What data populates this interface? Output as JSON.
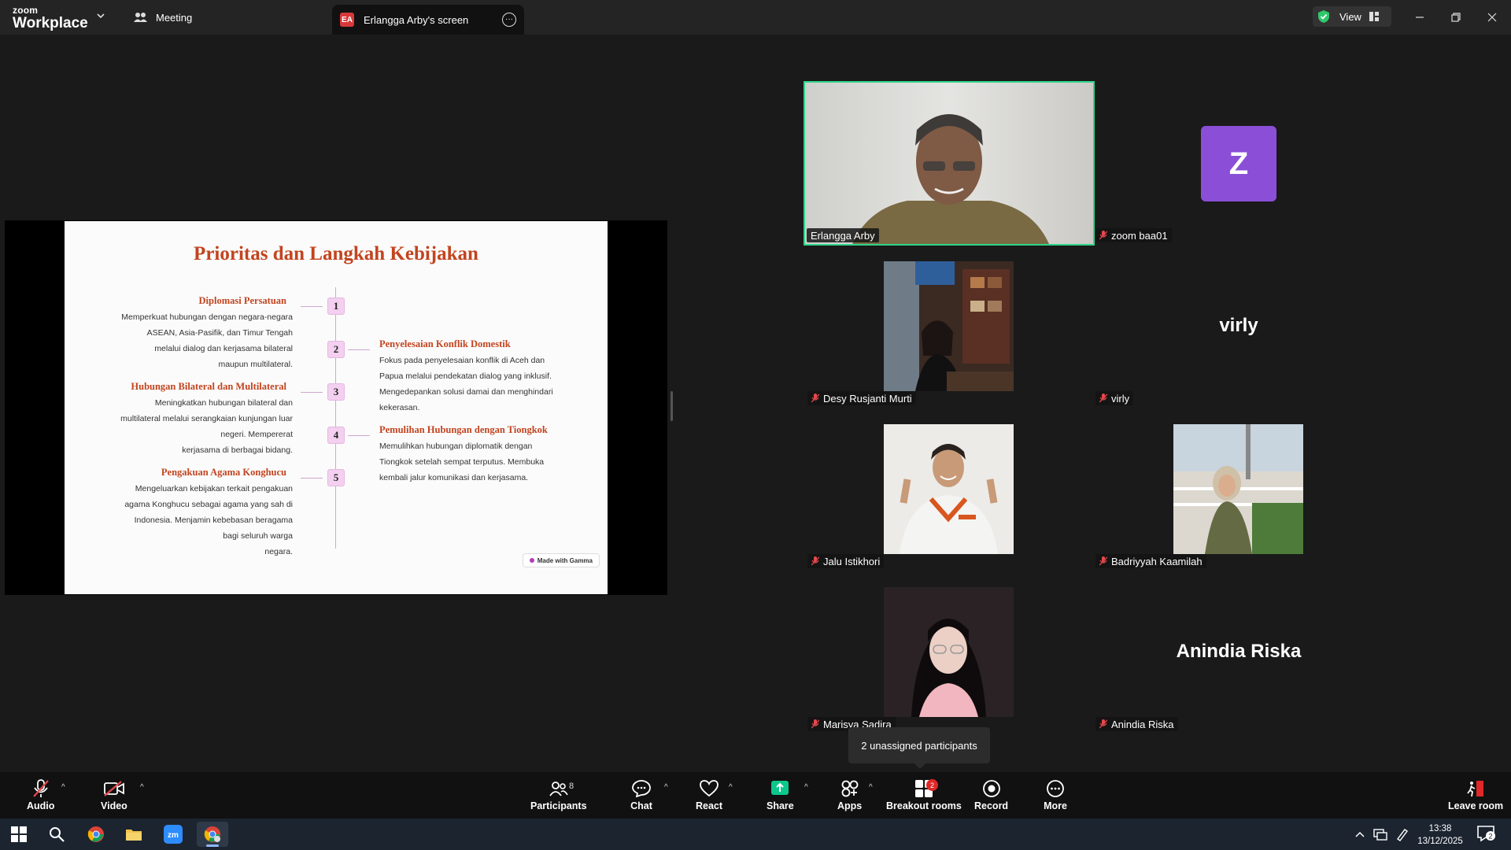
{
  "titlebar": {
    "brand_small": "zoom",
    "brand_big": "Workplace",
    "tab_meeting": "Meeting",
    "tab_screen_badge": "EA",
    "tab_screen_label": "Erlangga Arby's screen",
    "view_label": "View"
  },
  "slide": {
    "title": "Prioritas dan Langkah Kebijakan",
    "items": [
      {
        "num": "1",
        "head": "Diplomasi Persatuan",
        "lines": [
          "Memperkuat hubungan dengan negara-negara",
          "ASEAN, Asia-Pasifik, dan Timur Tengah",
          "melalui dialog dan kerjasama bilateral",
          "maupun multilateral."
        ]
      },
      {
        "num": "2",
        "head": "Penyelesaian Konflik Domestik",
        "lines": [
          "Fokus pada penyelesaian konflik di Aceh dan",
          "Papua melalui pendekatan dialog yang inklusif.",
          "Mengedepankan solusi damai dan menghindari",
          "kekerasan."
        ]
      },
      {
        "num": "3",
        "head": "Hubungan Bilateral dan Multilateral",
        "lines": [
          "Meningkatkan hubungan bilateral dan",
          "multilateral melalui serangkaian kunjungan luar",
          "negeri. Mempererat",
          "kerjasama di berbagai bidang."
        ]
      },
      {
        "num": "4",
        "head": "Pemulihan Hubungan dengan Tiongkok",
        "lines": [
          "Memulihkan hubungan diplomatik dengan",
          "Tiongkok setelah sempat terputus. Membuka",
          "kembali jalur komunikasi dan kerjasama."
        ]
      },
      {
        "num": "5",
        "head": "Pengakuan Agama Konghucu",
        "lines": [
          "Mengeluarkan kebijakan terkait pengakuan",
          "agama Konghucu sebagai agama yang sah di",
          "Indonesia. Menjamin kebebasan beragama",
          "bagi seluruh warga",
          "negara."
        ]
      }
    ],
    "gamma_badge": "Made with Gamma"
  },
  "participants": {
    "erlangga": "Erlangga Arby",
    "zoom": "zoom baa01",
    "zoom_initial": "Z",
    "desy": "Desy Rusjanti Murti",
    "virly": "virly",
    "virly_big": "virly",
    "jalu": "Jalu Istikhori",
    "badriyyah": "Badriyyah Kaamilah",
    "marisya": "Marisya Sadira",
    "anindia": "Anindia Riska",
    "anindia_big": "Anindia Riska"
  },
  "tooltip": "2 unassigned participants",
  "toolbar": {
    "audio": "Audio",
    "video": "Video",
    "participants": "Participants",
    "participants_count": "8",
    "chat": "Chat",
    "react": "React",
    "share": "Share",
    "apps": "Apps",
    "breakout": "Breakout rooms",
    "breakout_badge": "2",
    "record": "Record",
    "more": "More",
    "leave": "Leave room"
  },
  "taskbar": {
    "time": "13:38",
    "date": "13/12/2025",
    "notif_count": "2"
  },
  "colors": {
    "accent_green": "#2fd48a",
    "slide_heading": "#c2441f",
    "avatar_purple": "#8a4fd6",
    "mute_red": "#e5484d"
  }
}
